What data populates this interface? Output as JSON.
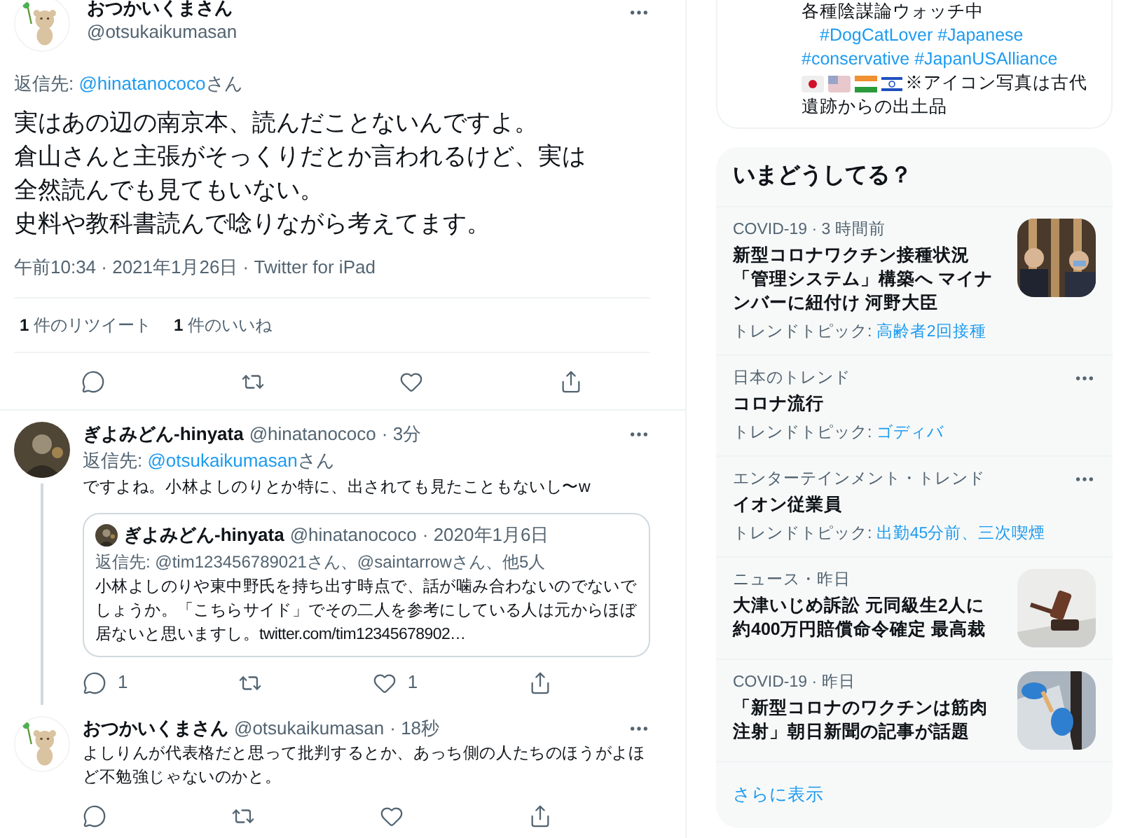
{
  "main_tweet": {
    "name": "おつかいくまさん",
    "handle": "@otsukaikumasan",
    "reply_label": "返信先: ",
    "reply_to": "@hinatanococo",
    "reply_suffix": "さん",
    "lines": [
      "実はあの辺の南京本、読んだことないんですよ。",
      "倉山さんと主張がそっくりだとか言われるけど、実は",
      "全然読んでも見てもいない。",
      "史料や教科書読んで唸りながら考えてます。"
    ],
    "meta": "午前10:34 · 2021年1月26日 · Twitter for iPad",
    "stats": [
      {
        "count": "1",
        "label": "件のリツイート"
      },
      {
        "count": "1",
        "label": "件のいいね"
      }
    ]
  },
  "replies": [
    {
      "name": "ぎよみどん-hinyata",
      "handle": "@hinatanococo",
      "time": "· 3分",
      "reply_label": "返信先: ",
      "reply_to": "@otsukaikumasan",
      "reply_suffix": "さん",
      "text": "ですよね。小林よしのりとか特に、出されても見たこともないし〜w",
      "thread_line": true,
      "quote": {
        "name": "ぎよみどん-hinyata",
        "handle": "@hinatanococo",
        "date": "· 2020年1月6日",
        "reply_line": "返信先: @tim123456789021さん、@saintarrowさん、他5人",
        "text": "小林よしのりや東中野氏を持ち出す時点で、話が噛み合わないのでないでしょうか。「こちらサイド」でその二人を参考にしている人は元からほぼ居ないと思いますし。twitter.com/tim12345678902…"
      },
      "reply_count": "1",
      "like_count": "1"
    },
    {
      "name": "おつかいくまさん",
      "handle": "@otsukaikumasan",
      "time": "· 18秒",
      "text": "よしりんが代表格だと思って批判するとか、あっち側の人たちのほうがよほど不勉強じゃないのかと。",
      "thread_line": false
    }
  ],
  "bio": {
    "lines": [
      {
        "kind": "text",
        "text": "各種陰謀論ウォッチ中"
      },
      {
        "kind": "tags",
        "text": "　#DogCatLover #Japanese"
      },
      {
        "kind": "tags",
        "text": "#conservative #JapanUSAlliance"
      },
      {
        "kind": "flags",
        "text": "※アイコン写真は古代遺跡からの出土品"
      }
    ]
  },
  "trends": {
    "title": "いまどうしてる？",
    "items": [
      {
        "context": "COVID-19 · 3 時間前",
        "headline": "新型コロナワクチン接種状況「管理システム」構築へ マイナンバーに紐付け 河野大臣",
        "topic_label": "トレンドトピック: ",
        "topic": "高齢者2回接種",
        "kind": "news"
      },
      {
        "context": "日本のトレンド",
        "headline": "コロナ流行",
        "topic_label": "トレンドトピック: ",
        "topic": "ゴディバ",
        "kind": "trend"
      },
      {
        "context": "エンターテインメント・トレンド",
        "headline": "イオン従業員",
        "topic_label": "トレンドトピック: ",
        "topic": "出勤45分前、三次喫煙",
        "kind": "trend"
      },
      {
        "context": "ニュース・昨日",
        "headline": "大津いじめ訴訟 元同級生2人に約400万円賠償命令確定 最高裁",
        "kind": "news"
      },
      {
        "context": "COVID-19 · 昨日",
        "headline": "「新型コロナのワクチンは筋肉注射」朝日新聞の記事が話題",
        "kind": "news"
      }
    ],
    "more": "さらに表示"
  }
}
